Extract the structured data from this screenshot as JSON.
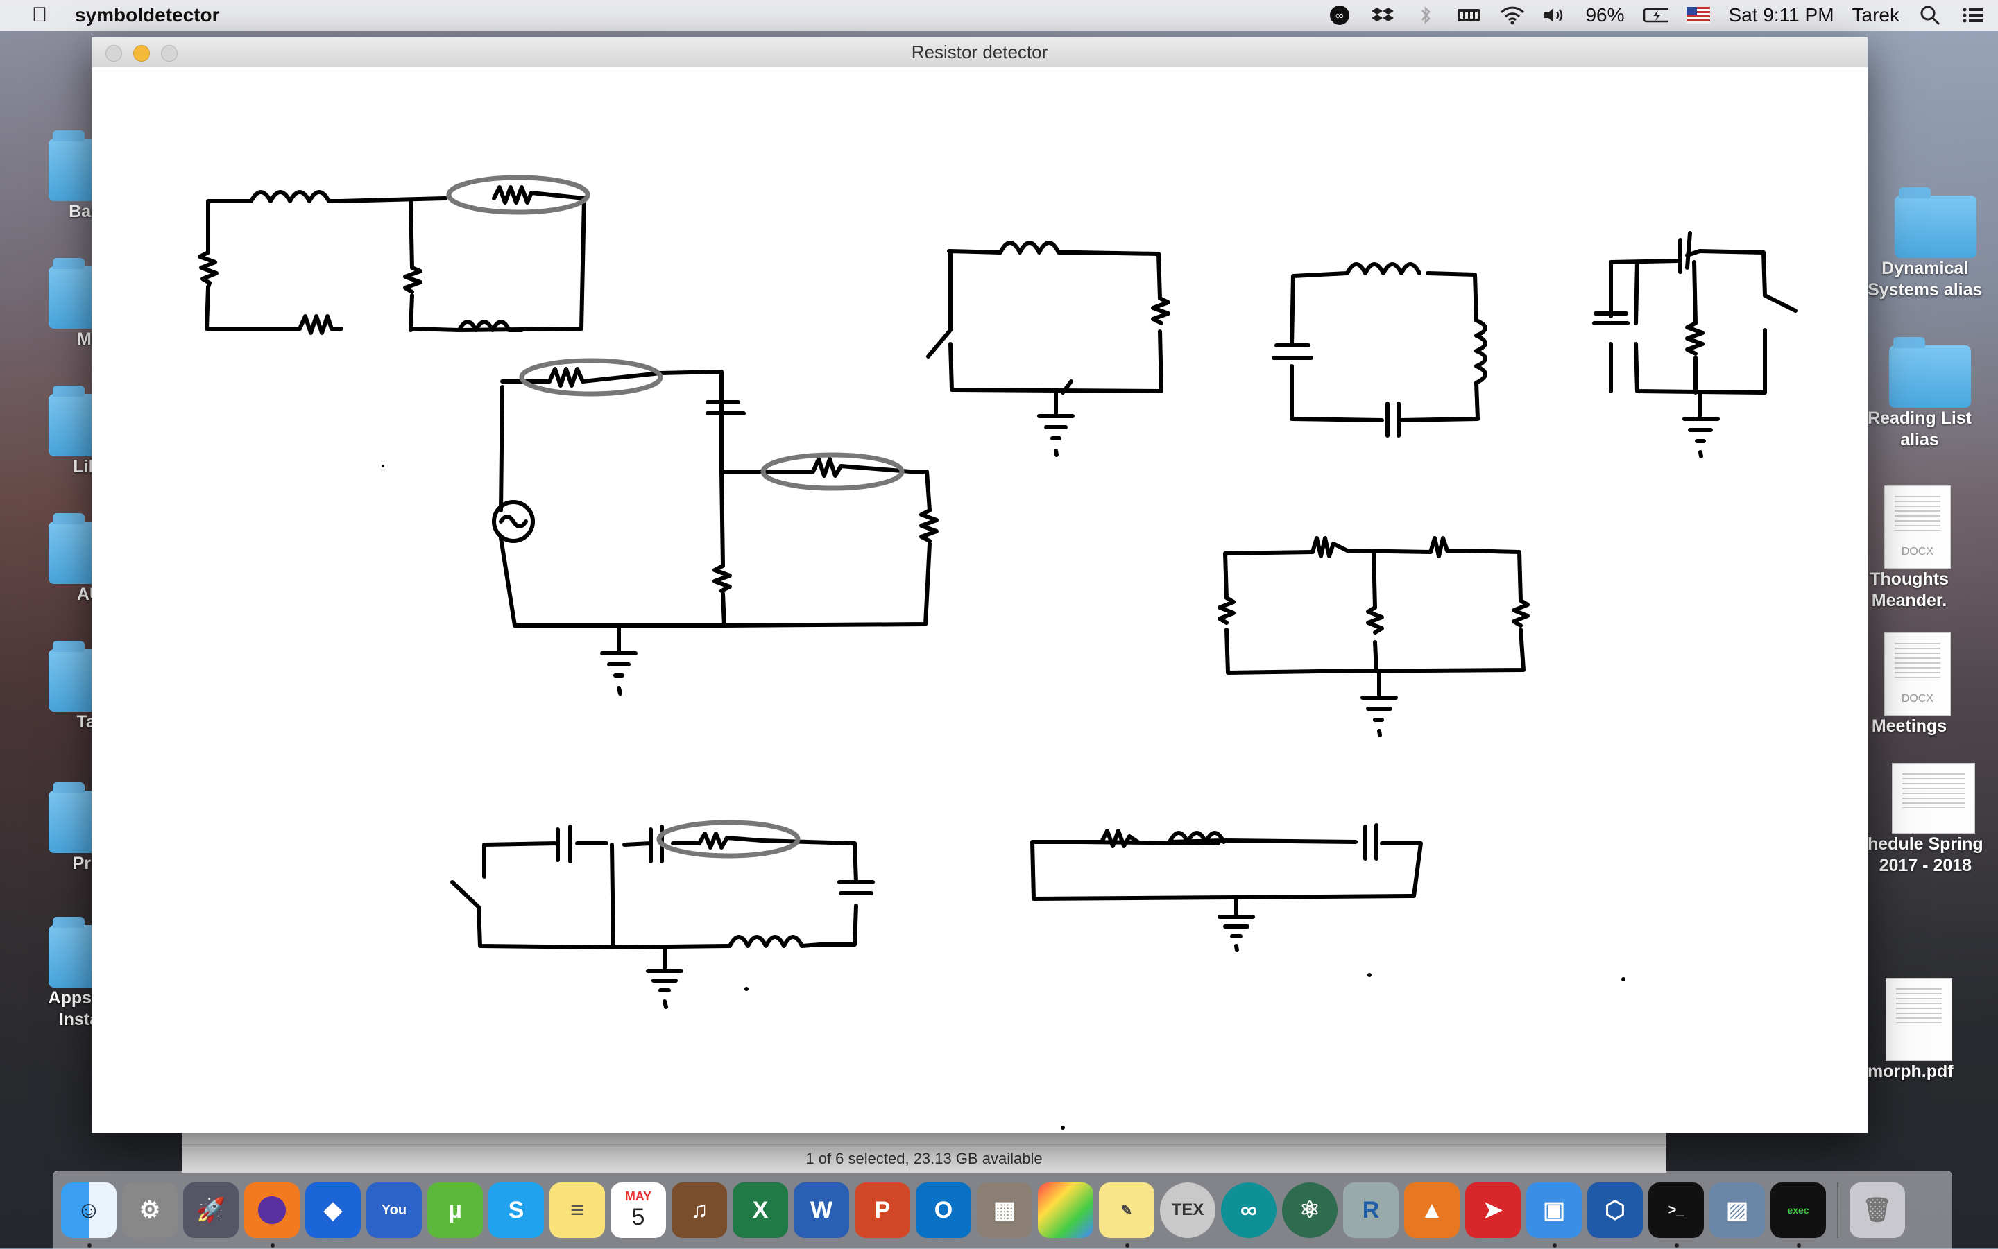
{
  "menubar": {
    "app_name": "symboldetector",
    "battery": "96%",
    "datetime": "Sat 9:11 PM",
    "user": "Tarek"
  },
  "desktop_left": [
    "Back",
    "Mu",
    "Libr",
    "AU",
    "Tar",
    "Proj",
    "Apps-D\nInsta"
  ],
  "desktop_right": [
    {
      "label": "Dynamical\nSystems alias",
      "kind": "folder"
    },
    {
      "label": "Reading List\nalias",
      "kind": "folder"
    },
    {
      "label": "Thoughts\nMeander.",
      "kind": "doc",
      "badge": "DOCX"
    },
    {
      "label": "Meetings",
      "kind": "doc",
      "badge": "DOCX"
    },
    {
      "label": "hedule Spring\n2017 - 2018",
      "kind": "sheet"
    },
    {
      "label": "morph.pdf",
      "kind": "doc"
    }
  ],
  "finder": {
    "status": "1 of 6 selected, 23.13 GB available"
  },
  "window": {
    "title": "Resistor detector"
  },
  "dock": {
    "calendar_month": "MAY",
    "calendar_day": "5",
    "tex_label": "TEX",
    "colors": {
      "accent": "#4aa7df",
      "highlight": "#777777"
    }
  }
}
